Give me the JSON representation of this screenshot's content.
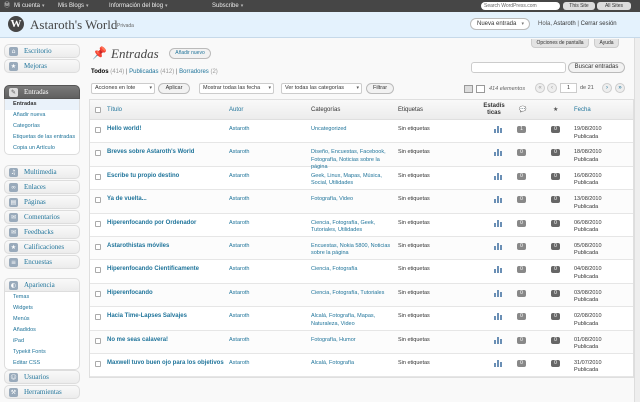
{
  "adminbar": {
    "account": "Mi cuenta",
    "blogs": "Mis Blogs",
    "blog_info": "Información del blog",
    "subscribe": "Subscribe",
    "search_placeholder": "Search WordPress.com",
    "this_site": "This Site",
    "all_sites": "All Sites"
  },
  "header": {
    "site_title": "Astaroth's World",
    "visibility": "Privada",
    "new_post": "Nueva entrada",
    "greeting_prefix": "Hola, ",
    "user": "Astaroth",
    "separator": " | ",
    "logout": "Cerrar sesión"
  },
  "screen_options": "Opciones de pantalla",
  "help": "Ayuda",
  "sidebar": {
    "dashboard": "Escritorio",
    "upgrades": "Mejoras",
    "posts": "Entradas",
    "posts_sub": [
      "Entradas",
      "Añadir nueva",
      "Categorías",
      "Etiquetas de las entradas",
      "Copia un Artículo"
    ],
    "media": "Multimedia",
    "links": "Enlaces",
    "pages": "Páginas",
    "comments": "Comentarios",
    "feedbacks": "Feedbacks",
    "ratings": "Calificaciones",
    "polls": "Encuestas",
    "appearance": "Apariencia",
    "appearance_sub": [
      "Temas",
      "Widgets",
      "Menús",
      "Añadidos",
      "iPad",
      "Typekit Fonts",
      "Editar CSS"
    ],
    "users": "Usuarios",
    "tools": "Herramientas"
  },
  "page": {
    "title": "Entradas",
    "add_new": "Añadir nuevo"
  },
  "filters": {
    "all": "Todos",
    "all_count": "(414)",
    "published": "Publicadas",
    "published_count": "(412)",
    "drafts": "Borradores",
    "drafts_count": "(2)",
    "sep": "|"
  },
  "search_button": "Buscar entradas",
  "toolbar": {
    "bulk": "Acciones en lote",
    "apply": "Aplicar",
    "dates": "Mostrar todas las fecha",
    "cats": "Ver todas las categorías",
    "filter": "Filtrar",
    "items": "414 elementos",
    "page": "1",
    "of": "de 21"
  },
  "columns": {
    "title": "Título",
    "author": "Autor",
    "categories": "Categorías",
    "tags": "Etiquetas",
    "stats": "Estadísticas",
    "date": "Fecha"
  },
  "posts": [
    {
      "title": "Hello world!",
      "author": "Astaroth",
      "categories": "Uncategorized",
      "tags": "Sin etiquetas",
      "comments": "1",
      "star": "0",
      "date": "19/08/2010",
      "status": "Publicada"
    },
    {
      "title": "Breves sobre Astaroth's World",
      "author": "Astaroth",
      "categories": "Diseño, Encuestas, Facebook, Fotografía, Noticias sobre la página",
      "tags": "Sin etiquetas",
      "comments": "0",
      "star": "0",
      "date": "18/08/2010",
      "status": "Publicada"
    },
    {
      "title": "Escribe tu propio destino",
      "author": "Astaroth",
      "categories": "Geek, Linux, Mapas, Música, Social, Utilidades",
      "tags": "Sin etiquetas",
      "comments": "0",
      "star": "0",
      "date": "16/08/2010",
      "status": "Publicada"
    },
    {
      "title": "Ya de vuelta...",
      "author": "Astaroth",
      "categories": "Fotografía, Video",
      "tags": "Sin etiquetas",
      "comments": "0",
      "star": "0",
      "date": "13/08/2010",
      "status": "Publicada"
    },
    {
      "title": "Hiperenfocando por Ordenador",
      "author": "Astaroth",
      "categories": "Ciencia, Fotografía, Geek, Tutoriales, Utilidades",
      "tags": "Sin etiquetas",
      "comments": "0",
      "star": "0",
      "date": "06/08/2010",
      "status": "Publicada"
    },
    {
      "title": "Astarothistas móviles",
      "author": "Astaroth",
      "categories": "Encuestas, Nokia 5800, Noticias sobre la página",
      "tags": "Sin etiquetas",
      "comments": "0",
      "star": "0",
      "date": "05/08/2010",
      "status": "Publicada"
    },
    {
      "title": "Hiperenfocando Científicamente",
      "author": "Astaroth",
      "categories": "Ciencia, Fotografía",
      "tags": "Sin etiquetas",
      "comments": "0",
      "star": "0",
      "date": "04/08/2010",
      "status": "Publicada"
    },
    {
      "title": "Hiperenfocando",
      "author": "Astaroth",
      "categories": "Ciencia, Fotografía, Tutoriales",
      "tags": "Sin etiquetas",
      "comments": "0",
      "star": "0",
      "date": "03/08/2010",
      "status": "Publicada"
    },
    {
      "title": "Hacia Time-Lapses Salvajes",
      "author": "Astaroth",
      "categories": "Alcalá, Fotografía, Mapas, Naturaleza, Video",
      "tags": "Sin etiquetas",
      "comments": "0",
      "star": "0",
      "date": "02/08/2010",
      "status": "Publicada"
    },
    {
      "title": "No me seas calavera!",
      "author": "Astaroth",
      "categories": "Fotografía, Humor",
      "tags": "Sin etiquetas",
      "comments": "0",
      "star": "0",
      "date": "01/08/2010",
      "status": "Publicada"
    },
    {
      "title": "Maxwell tuvo buen ojo para los objetivos",
      "author": "Astaroth",
      "categories": "Alcalá, Fotografía",
      "tags": "Sin etiquetas",
      "comments": "0",
      "star": "0",
      "date": "31/07/2010",
      "status": "Publicada"
    }
  ]
}
